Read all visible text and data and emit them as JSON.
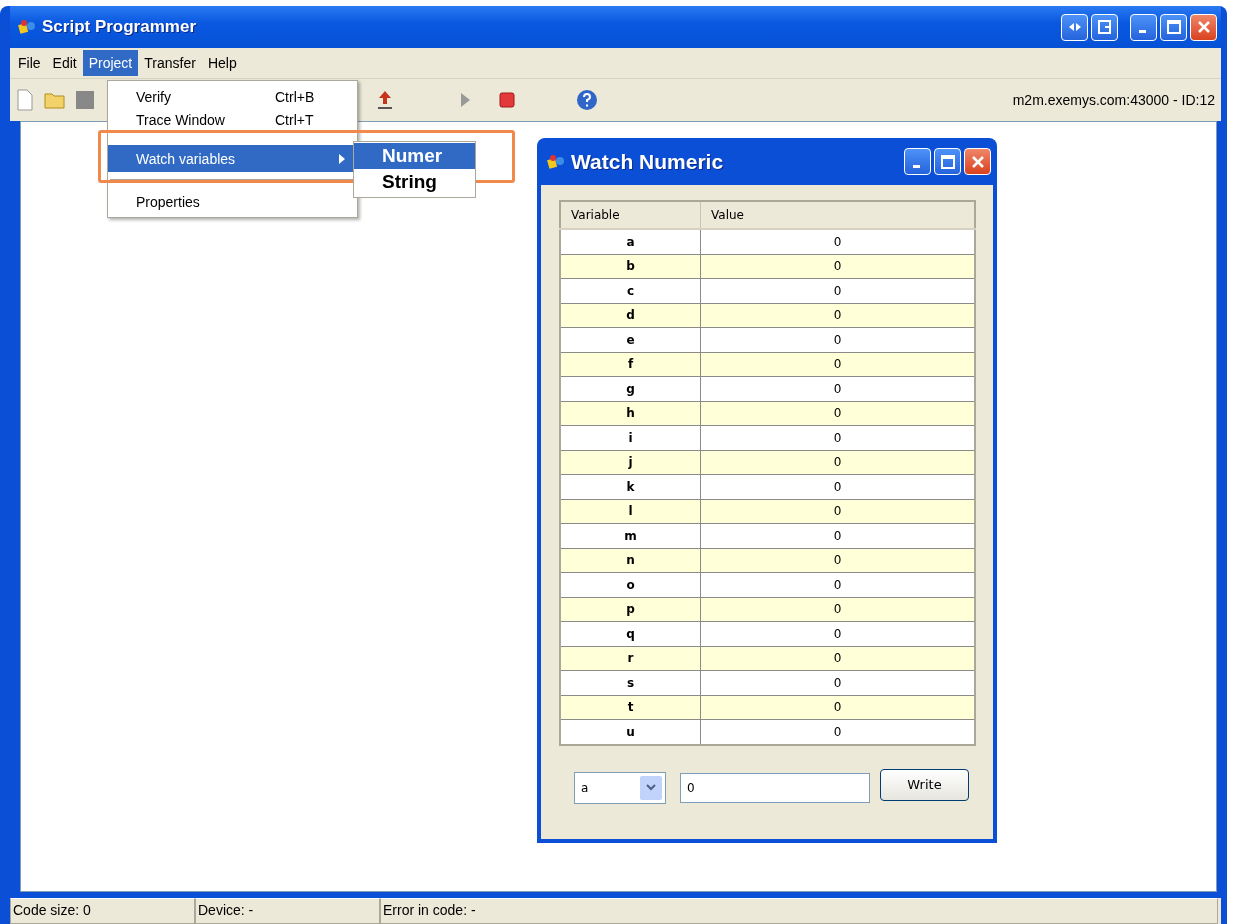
{
  "window": {
    "title": "Script Programmer"
  },
  "menu_bar": [
    {
      "label": "File",
      "selected": false
    },
    {
      "label": "Edit",
      "selected": false
    },
    {
      "label": "Project",
      "selected": true
    },
    {
      "label": "Transfer",
      "selected": false
    },
    {
      "label": "Help",
      "selected": false
    }
  ],
  "project_menu": [
    {
      "kind": "item",
      "label": "Verify",
      "shortcut": "Ctrl+B",
      "selected": false
    },
    {
      "kind": "item",
      "label": "Trace Window",
      "shortcut": "Ctrl+T",
      "selected": false
    },
    {
      "kind": "submenu",
      "label": "Watch variables",
      "selected": true
    },
    {
      "kind": "separator"
    },
    {
      "kind": "item",
      "label": "Properties",
      "selected": false
    }
  ],
  "watch_submenu": [
    {
      "label": "Numer",
      "selected": true
    },
    {
      "label": "String",
      "selected": false
    }
  ],
  "toolbar": {
    "connection": "m2m.exemys.com:43000 - ID:12"
  },
  "watch_window": {
    "title": "Watch Numeric",
    "table": {
      "columns": [
        "Variable",
        "Value"
      ],
      "rows": [
        {
          "variable": "a",
          "value": "0"
        },
        {
          "variable": "b",
          "value": "0"
        },
        {
          "variable": "c",
          "value": "0"
        },
        {
          "variable": "d",
          "value": "0"
        },
        {
          "variable": "e",
          "value": "0"
        },
        {
          "variable": "f",
          "value": "0"
        },
        {
          "variable": "g",
          "value": "0"
        },
        {
          "variable": "h",
          "value": "0"
        },
        {
          "variable": "i",
          "value": "0"
        },
        {
          "variable": "j",
          "value": "0"
        },
        {
          "variable": "k",
          "value": "0"
        },
        {
          "variable": "l",
          "value": "0"
        },
        {
          "variable": "m",
          "value": "0"
        },
        {
          "variable": "n",
          "value": "0"
        },
        {
          "variable": "o",
          "value": "0"
        },
        {
          "variable": "p",
          "value": "0"
        },
        {
          "variable": "q",
          "value": "0"
        },
        {
          "variable": "r",
          "value": "0"
        },
        {
          "variable": "s",
          "value": "0"
        },
        {
          "variable": "t",
          "value": "0"
        },
        {
          "variable": "u",
          "value": "0"
        }
      ]
    },
    "variable_select": "a",
    "value_input": "0",
    "write_button": "Write"
  },
  "status_bar": [
    "Code size: 0",
    "Device: -",
    "Error in code: -"
  ]
}
